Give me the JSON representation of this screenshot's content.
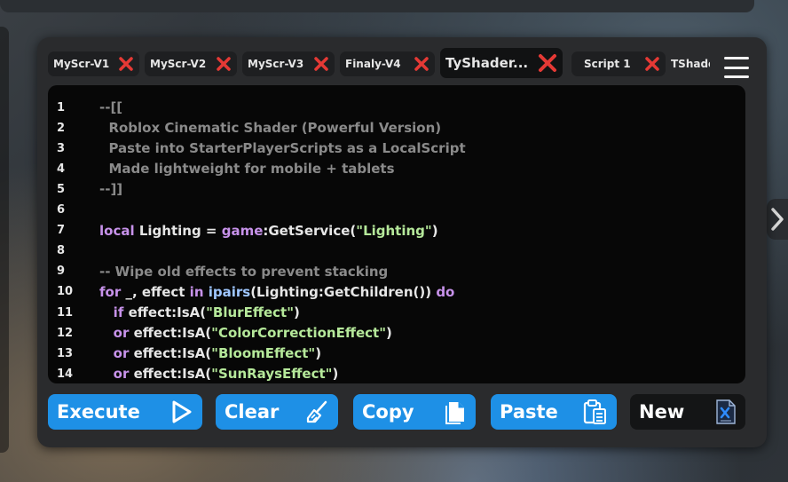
{
  "tabs": [
    {
      "label": "MyScr-V1",
      "active": false
    },
    {
      "label": "MyScr-V2",
      "active": false
    },
    {
      "label": "MyScr-V3",
      "active": false
    },
    {
      "label": "Finaly-V4",
      "active": false
    },
    {
      "label": "TyShader...",
      "active": true
    },
    {
      "label": "Script 1",
      "active": false
    },
    {
      "label": "TShade",
      "active": false
    }
  ],
  "editor": {
    "lines": [
      {
        "num": "1",
        "tokens": [
          {
            "t": "--[[",
            "c": "comment"
          }
        ]
      },
      {
        "num": "2",
        "tokens": [
          {
            "t": "  Roblox Cinematic Shader (Powerful Version)",
            "c": "comment"
          }
        ]
      },
      {
        "num": "3",
        "tokens": [
          {
            "t": "  Paste into StarterPlayerScripts as a LocalScript",
            "c": "comment"
          }
        ]
      },
      {
        "num": "4",
        "tokens": [
          {
            "t": "  Made lightweight for mobile + tablets",
            "c": "comment"
          }
        ]
      },
      {
        "num": "5",
        "tokens": [
          {
            "t": "--]]",
            "c": "comment"
          }
        ]
      },
      {
        "num": "6",
        "tokens": []
      },
      {
        "num": "7",
        "tokens": [
          {
            "t": "local",
            "c": "kw"
          },
          {
            "t": " Lighting = ",
            "c": "var"
          },
          {
            "t": "game",
            "c": "kw"
          },
          {
            "t": ":GetService(",
            "c": "var"
          },
          {
            "t": "\"Lighting\"",
            "c": "str"
          },
          {
            "t": ")",
            "c": "var"
          }
        ]
      },
      {
        "num": "8",
        "tokens": []
      },
      {
        "num": "9",
        "tokens": [
          {
            "t": "-- Wipe old effects to prevent stacking",
            "c": "comment"
          }
        ]
      },
      {
        "num": "10",
        "tokens": [
          {
            "t": "for",
            "c": "kw"
          },
          {
            "t": " _, effect ",
            "c": "var"
          },
          {
            "t": "in",
            "c": "kw"
          },
          {
            "t": " ",
            "c": "var"
          },
          {
            "t": "ipairs",
            "c": "fn"
          },
          {
            "t": "(Lighting:GetChildren()) ",
            "c": "var"
          },
          {
            "t": "do",
            "c": "kw"
          }
        ]
      },
      {
        "num": "11",
        "tokens": [
          {
            "t": "   ",
            "c": "var"
          },
          {
            "t": "if",
            "c": "kw"
          },
          {
            "t": " effect:IsA(",
            "c": "var"
          },
          {
            "t": "\"BlurEffect\"",
            "c": "str"
          },
          {
            "t": ")",
            "c": "var"
          }
        ]
      },
      {
        "num": "12",
        "tokens": [
          {
            "t": "   ",
            "c": "var"
          },
          {
            "t": "or",
            "c": "kw"
          },
          {
            "t": " effect:IsA(",
            "c": "var"
          },
          {
            "t": "\"ColorCorrectionEffect\"",
            "c": "str"
          },
          {
            "t": ")",
            "c": "var"
          }
        ]
      },
      {
        "num": "13",
        "tokens": [
          {
            "t": "   ",
            "c": "var"
          },
          {
            "t": "or",
            "c": "kw"
          },
          {
            "t": " effect:IsA(",
            "c": "var"
          },
          {
            "t": "\"BloomEffect\"",
            "c": "str"
          },
          {
            "t": ")",
            "c": "var"
          }
        ]
      },
      {
        "num": "14",
        "tokens": [
          {
            "t": "   ",
            "c": "var"
          },
          {
            "t": "or",
            "c": "kw"
          },
          {
            "t": " effect:IsA(",
            "c": "var"
          },
          {
            "t": "\"SunRaysEffect\"",
            "c": "str"
          },
          {
            "t": ")",
            "c": "var"
          }
        ]
      }
    ]
  },
  "toolbar": {
    "execute_label": "Execute",
    "clear_label": "Clear",
    "copy_label": "Copy",
    "paste_label": "Paste",
    "new_label": "New"
  },
  "colors": {
    "accent": "#1e90e6",
    "close_red": "#e53935",
    "comment": "#8a8a8a",
    "keyword": "#c792ea",
    "string": "#b5e89a",
    "function": "#9fc7ff"
  },
  "icons": {
    "tab_close": "close-x-icon",
    "menu": "hamburger-menu-icon",
    "execute": "play-icon",
    "clear": "broom-icon",
    "copy": "copy-document-icon",
    "paste": "clipboard-icon",
    "new": "new-file-icon",
    "side": "chevron-right-icon"
  }
}
